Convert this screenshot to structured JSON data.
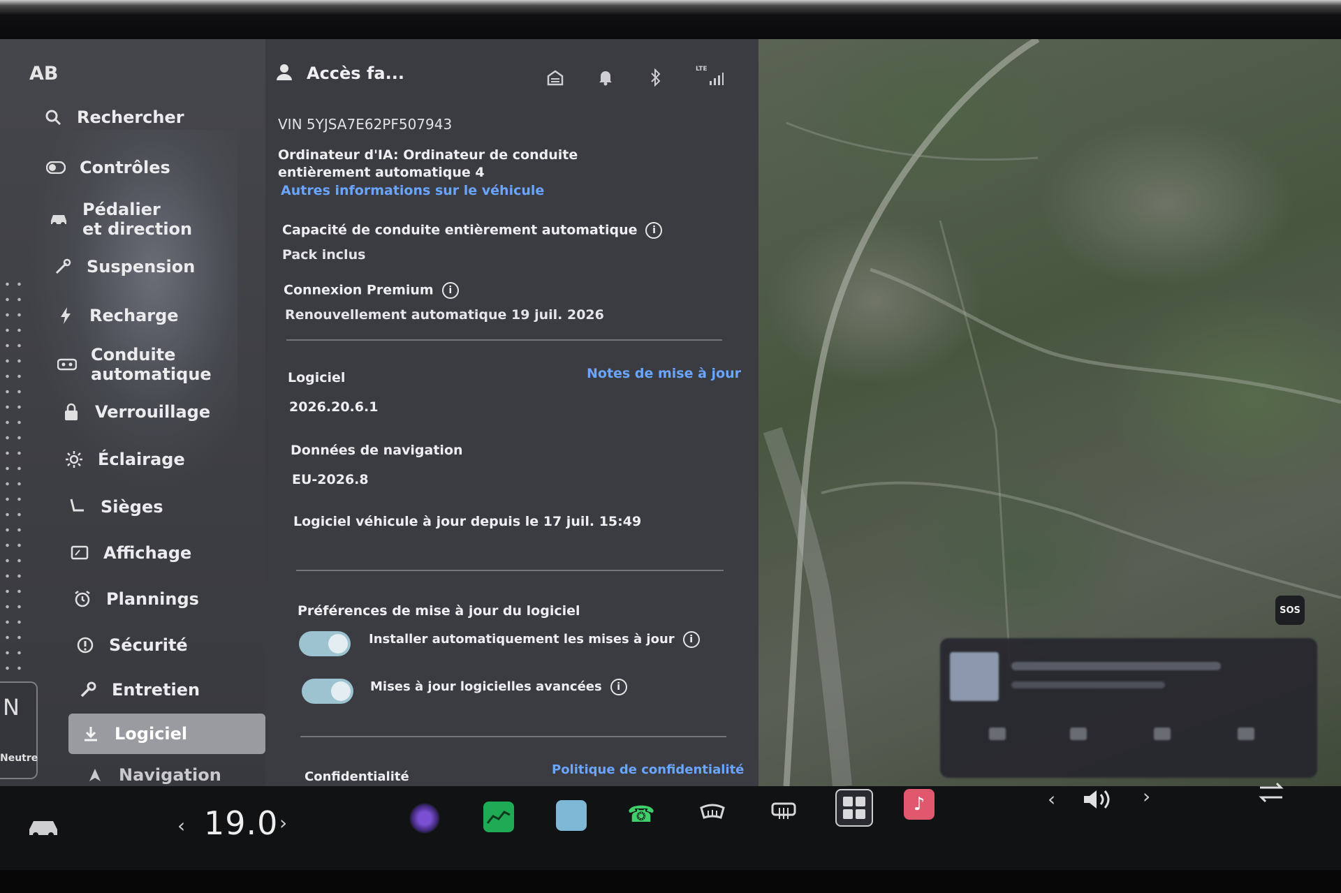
{
  "sidebar": {
    "initials": "AB",
    "items": [
      {
        "label": "Rechercher",
        "icon": "search-icon"
      },
      {
        "label": "Contrôles",
        "icon": "toggle-icon"
      },
      {
        "label": "Pédalier\net direction",
        "icon": "car-icon"
      },
      {
        "label": "Suspension",
        "icon": "wrench-icon"
      },
      {
        "label": "Recharge",
        "icon": "lightning-icon"
      },
      {
        "label": "Conduite\nautomatique",
        "icon": "steering-wheel-icon"
      },
      {
        "label": "Verrouillage",
        "icon": "lock-icon"
      },
      {
        "label": "Éclairage",
        "icon": "sun-icon"
      },
      {
        "label": "Sièges",
        "icon": "seat-icon"
      },
      {
        "label": "Affichage",
        "icon": "display-icon"
      },
      {
        "label": "Plannings",
        "icon": "alarm-clock-icon"
      },
      {
        "label": "Sécurité",
        "icon": "shield-icon"
      },
      {
        "label": "Entretien",
        "icon": "wrench-icon"
      },
      {
        "label": "Logiciel",
        "icon": "download-icon",
        "active": true
      },
      {
        "label": "Navigation",
        "icon": "navigation-arrow-icon"
      }
    ],
    "gear": {
      "letter": "N",
      "label": "Neutre"
    }
  },
  "header": {
    "user_label": "Accès fa...",
    "icons": [
      "garage-icon",
      "bell-icon",
      "bluetooth-icon",
      "lte-signal-icon"
    ],
    "lte_text": "LTE"
  },
  "vehicle": {
    "vin": "VIN 5YJSA7E62PF507943",
    "computer": "Ordinateur d'IA: Ordinateur de conduite entièrement automatique 4",
    "more_info_link": "Autres informations sur le véhicule"
  },
  "fsd": {
    "title": "Capacité de conduite entièrement automatique",
    "value": "Pack inclus"
  },
  "premium": {
    "title": "Connexion Premium",
    "value": "Renouvellement automatique 19 juil. 2026"
  },
  "software": {
    "title": "Logiciel",
    "release_notes_link": "Notes de mise à jour",
    "version": "2026.20.6.1",
    "nav_data_title": "Données de navigation",
    "nav_data_value": "EU-2026.8",
    "up_to_date": "Logiciel véhicule à jour depuis le 17 juil. 15:49"
  },
  "preferences": {
    "title": "Préférences de mise à jour du logiciel",
    "toggles": [
      {
        "label": "Installer automatiquement les mises à jour",
        "on": true
      },
      {
        "label": "Mises à jour logicielles avancées",
        "on": true
      }
    ]
  },
  "privacy": {
    "title": "Confidentialité",
    "policy_link": "Politique de confidentialité"
  },
  "map": {
    "sos_label": "SOS"
  },
  "dock": {
    "temperature": "19.0",
    "apps": [
      "camera-icon",
      "energy-chart-icon",
      "toybox-icon",
      "phone-icon",
      "rear-defrost-icon",
      "front-defrost-icon",
      "app-launcher-icon",
      "music-icon"
    ],
    "volume_icon": "volume-icon",
    "switch_icon": "swap-arrows-icon"
  },
  "colors": {
    "accent_link": "#6aa5ff",
    "toggle_on": "#9cc3cf",
    "panel_bg": "#3b3c41"
  }
}
